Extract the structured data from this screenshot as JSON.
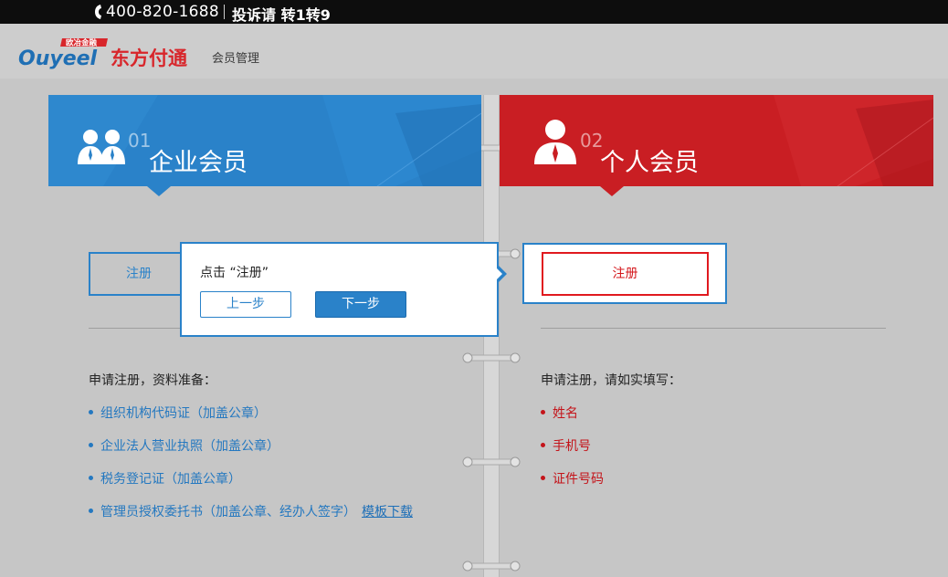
{
  "topbar": {
    "hotline": "400-820-1688",
    "complaint": "投诉请 转1转9"
  },
  "header": {
    "logo_brand": "Ouyeel",
    "logo_badge": "欧冶金融",
    "logo_cn": "东方付通",
    "logo_sub": "会员管理"
  },
  "enterprise": {
    "num": "01",
    "title": "企业会员",
    "register_label": "注册",
    "list_title": "申请注册，资料准备：",
    "items": [
      "组织机构代码证（加盖公章）",
      "企业法人营业执照（加盖公章）",
      "税务登记证（加盖公章）",
      "管理员授权委托书（加盖公章、经办人签字）"
    ],
    "template_link": "模板下载"
  },
  "personal": {
    "num": "02",
    "title": "个人会员",
    "register_label": "注册",
    "list_title": "申请注册，请如实填写：",
    "items": [
      "姓名",
      "手机号",
      "证件号码"
    ]
  },
  "guide": {
    "text": "点击 “注册”",
    "prev_label": "上一步",
    "next_label": "下一步"
  },
  "colors": {
    "blue": "#2a82c9",
    "red": "#c91e23"
  }
}
